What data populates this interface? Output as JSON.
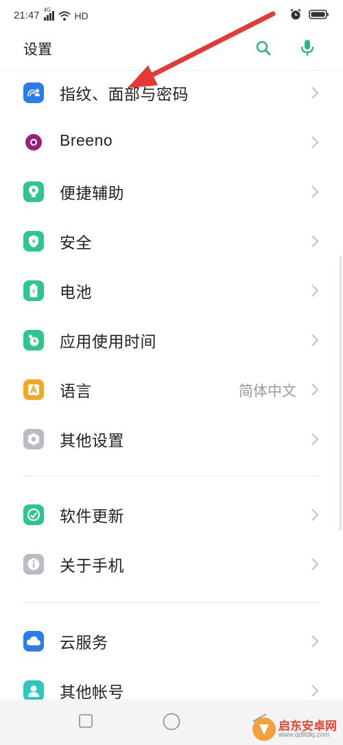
{
  "status_bar": {
    "time": "21:47",
    "network": "4G",
    "hd": "HD"
  },
  "header": {
    "title": "设置",
    "search_icon": "search-icon",
    "mic_icon": "mic-icon",
    "accent_color": "#2fb777"
  },
  "settings": {
    "items": [
      {
        "label": "指纹、面部与密码",
        "icon": "fingerprint-face-icon",
        "color": "#2b7de9"
      },
      {
        "label": "Breeno",
        "icon": "breeno-icon",
        "color": "#9c1f7b"
      },
      {
        "label": "便捷辅助",
        "icon": "assist-icon",
        "color": "#2fc68a"
      },
      {
        "label": "安全",
        "icon": "shield-icon",
        "color": "#2fc68a"
      },
      {
        "label": "电池",
        "icon": "battery-icon",
        "color": "#2fc68a"
      },
      {
        "label": "应用使用时间",
        "icon": "app-usage-icon",
        "color": "#2fc68a"
      },
      {
        "label": "语言",
        "value": "简体中文",
        "icon": "language-icon",
        "color": "#f5a623"
      },
      {
        "label": "其他设置",
        "icon": "other-settings-icon",
        "color": "#b8bcc4"
      },
      {
        "label": "软件更新",
        "icon": "software-update-icon",
        "color": "#2fc68a"
      },
      {
        "label": "关于手机",
        "icon": "about-phone-icon",
        "color": "#b8bcc4"
      },
      {
        "label": "云服务",
        "icon": "cloud-icon",
        "color": "#2b7de9"
      },
      {
        "label": "其他帐号",
        "icon": "account-icon",
        "color": "#2fc6c0"
      }
    ]
  },
  "watermark": {
    "title": "启东安卓网",
    "url": "www.qdltdkj.com"
  },
  "annotation_color": "#e53935"
}
